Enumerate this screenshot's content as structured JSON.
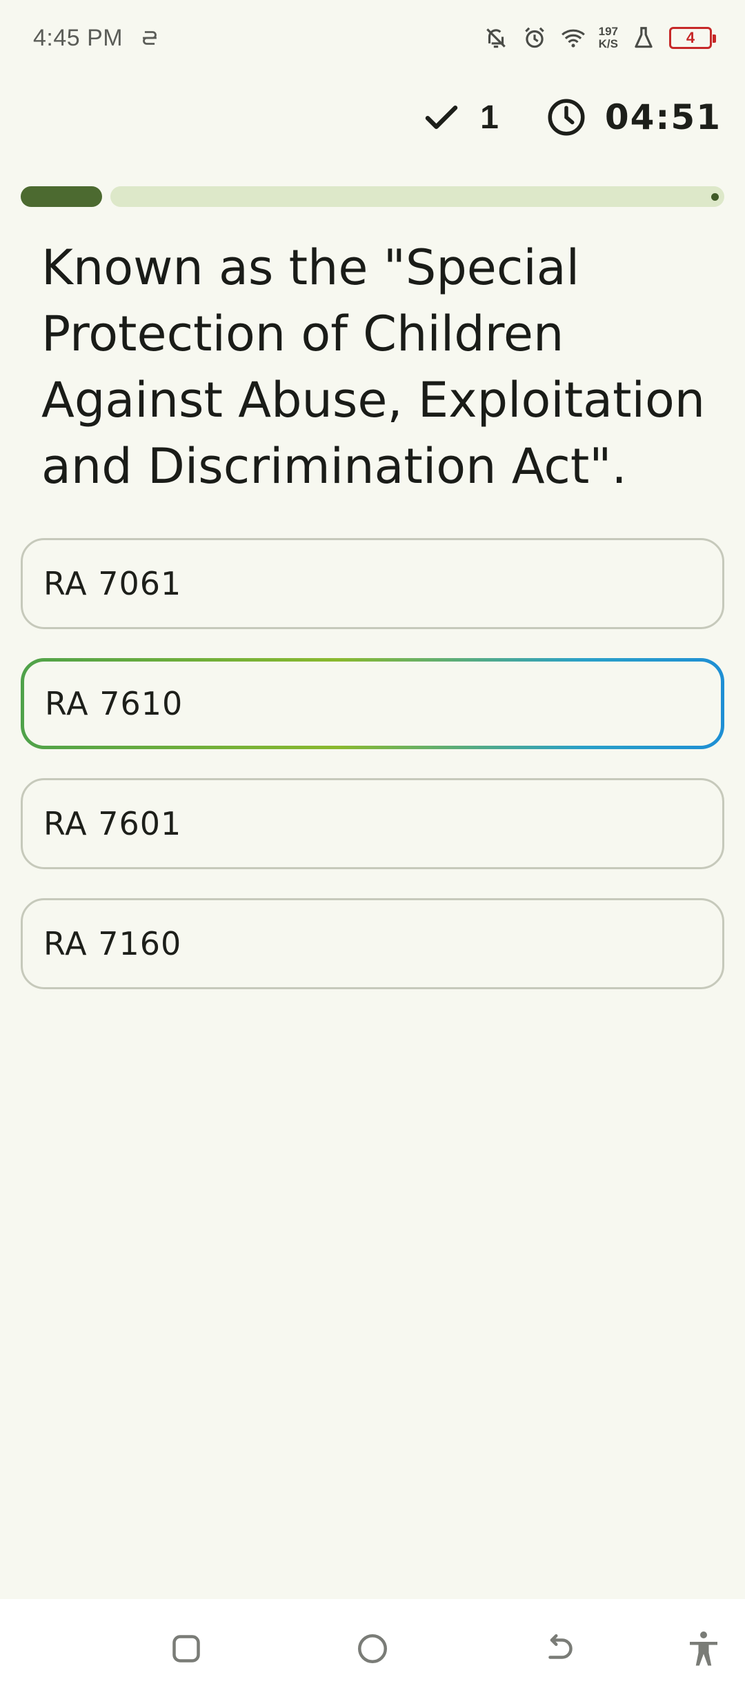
{
  "status_bar": {
    "time": "4:45 PM",
    "net_speed_value": "197",
    "net_speed_unit": "K/S",
    "battery_level": "4",
    "icons": [
      "sync-icon",
      "bell-off-icon",
      "alarm-icon",
      "wifi-icon",
      "lab-flask-icon",
      "battery-icon"
    ],
    "battery_color": "#c62828"
  },
  "header": {
    "correct_count": "1",
    "timer": "04:51",
    "icons": [
      "check-icon",
      "clock-icon"
    ]
  },
  "progress": {
    "fraction": 0.12,
    "fill_color": "#4c6a30",
    "track_color": "#dde8c9"
  },
  "question": {
    "text": "Known as the \"Special Protection of Children Against Abuse, Exploitation and Discrimination Act\"."
  },
  "options": [
    {
      "label": "RA 7061",
      "selected": false
    },
    {
      "label": "RA 7610",
      "selected": true
    },
    {
      "label": "RA 7601",
      "selected": false
    },
    {
      "label": "RA 7160",
      "selected": false
    }
  ],
  "nav_bar": {
    "icons": [
      "recent-apps-icon",
      "home-icon",
      "back-icon",
      "accessibility-icon"
    ]
  },
  "colors": {
    "background": "#f7f8f0",
    "selected_gradient_start": "#4fa24a",
    "selected_gradient_end": "#1e8fd4"
  }
}
